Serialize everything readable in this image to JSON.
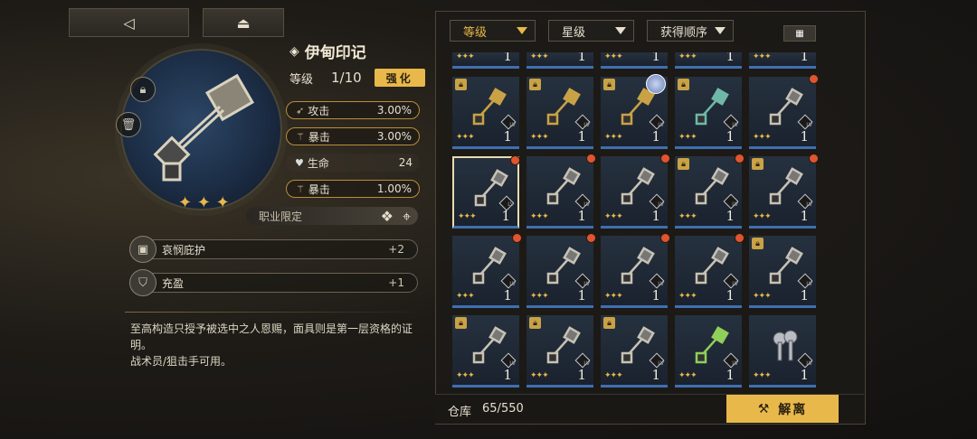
{
  "nav": {
    "back_icon": "back-arrow-icon",
    "home_icon": "home-icon"
  },
  "item": {
    "name": "伊甸印记",
    "level_label": "等级",
    "level_value": "1/10",
    "enhance_label": "强化",
    "rarity_stars": 3
  },
  "stats": [
    {
      "label": "攻击",
      "value": "3.00%",
      "style": "gold",
      "icon": "attack-icon"
    },
    {
      "label": "暴击",
      "value": "3.00%",
      "style": "gold",
      "icon": "crit-icon"
    },
    {
      "label": "生命",
      "value": "24",
      "style": "plain",
      "icon": "heart-icon"
    },
    {
      "label": "暴击",
      "value": "1.00%",
      "style": "gold",
      "icon": "crit-icon"
    }
  ],
  "class_limit": {
    "label": "职业限定"
  },
  "perks": [
    {
      "name": "哀悯庇护",
      "value": "+2"
    },
    {
      "name": "充盈",
      "value": "+1"
    }
  ],
  "description": {
    "line1": "至高构造只授予被选中之人恩赐，面具则是第一层资格的证明。",
    "line2": "战术员/狙击手可用。"
  },
  "filters": {
    "level": "等级",
    "star": "星级",
    "order": "获得顺序"
  },
  "inventory": {
    "top_row_levels": [
      "1",
      "1",
      "1",
      "1",
      "1"
    ],
    "rows": [
      [
        {
          "lock": true,
          "dot": false,
          "avatar": false,
          "level": "1",
          "variant": "gold"
        },
        {
          "lock": true,
          "dot": false,
          "avatar": false,
          "level": "1",
          "variant": "gold"
        },
        {
          "lock": true,
          "dot": false,
          "avatar": true,
          "level": "1",
          "variant": "gold"
        },
        {
          "lock": true,
          "dot": false,
          "avatar": false,
          "level": "1",
          "variant": "teal"
        },
        {
          "lock": false,
          "dot": true,
          "avatar": false,
          "level": "1",
          "variant": "silver"
        }
      ],
      [
        {
          "lock": false,
          "dot": true,
          "avatar": false,
          "level": "1",
          "variant": "silver",
          "selected": true
        },
        {
          "lock": false,
          "dot": true,
          "avatar": false,
          "level": "1",
          "variant": "silver"
        },
        {
          "lock": false,
          "dot": true,
          "avatar": false,
          "level": "1",
          "variant": "silver"
        },
        {
          "lock": true,
          "dot": true,
          "avatar": false,
          "level": "1",
          "variant": "silver"
        },
        {
          "lock": true,
          "dot": true,
          "avatar": false,
          "level": "1",
          "variant": "silver"
        }
      ],
      [
        {
          "lock": false,
          "dot": true,
          "avatar": false,
          "level": "1",
          "variant": "silver"
        },
        {
          "lock": false,
          "dot": true,
          "avatar": false,
          "level": "1",
          "variant": "silver"
        },
        {
          "lock": false,
          "dot": true,
          "avatar": false,
          "level": "1",
          "variant": "silver"
        },
        {
          "lock": false,
          "dot": true,
          "avatar": false,
          "level": "1",
          "variant": "silver"
        },
        {
          "lock": true,
          "dot": false,
          "avatar": false,
          "level": "1",
          "variant": "silver"
        }
      ],
      [
        {
          "lock": true,
          "dot": false,
          "avatar": false,
          "level": "1",
          "variant": "silver"
        },
        {
          "lock": true,
          "dot": false,
          "avatar": false,
          "level": "1",
          "variant": "silver"
        },
        {
          "lock": true,
          "dot": false,
          "avatar": false,
          "level": "1",
          "variant": "silver"
        },
        {
          "lock": false,
          "dot": false,
          "avatar": false,
          "level": "1",
          "variant": "green"
        },
        {
          "lock": false,
          "dot": false,
          "avatar": false,
          "level": "1",
          "variant": "keys"
        }
      ]
    ]
  },
  "footer": {
    "storage_label": "仓库",
    "storage_value": "65/550",
    "release_label": "解离"
  },
  "colors": {
    "accent": "#e8b84a",
    "card_bar": "#3f6fb0",
    "new_dot": "#e05530"
  }
}
